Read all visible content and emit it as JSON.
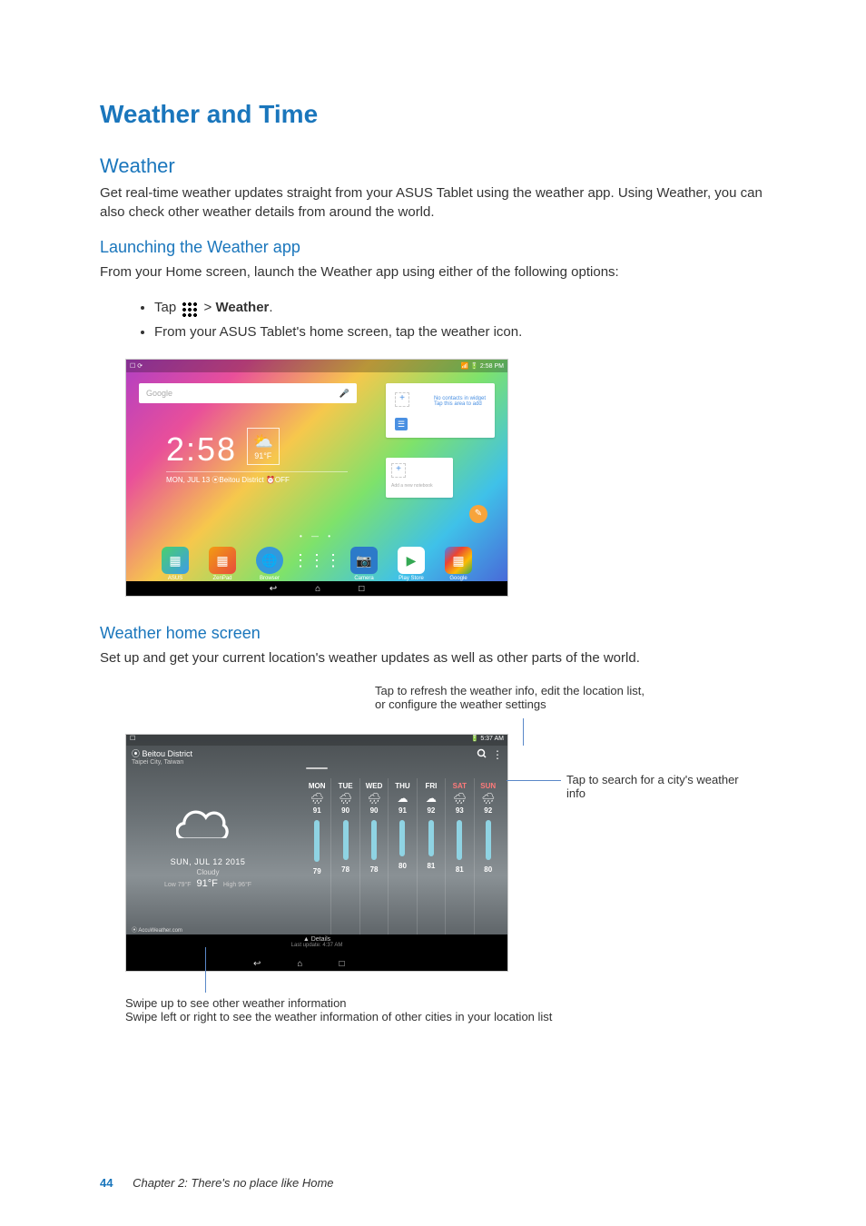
{
  "title": "Weather and Time",
  "weather_h": "Weather",
  "weather_p": "Get real-time weather updates straight from your ASUS Tablet using the weather app. Using Weather, you can also check other weather details from around the world.",
  "launch_h": "Launching the Weather app",
  "launch_p": "From your Home screen, launch the Weather app using either of the following options:",
  "li1_pre": "Tap",
  "li1_post": "> ",
  "li1_bold": "Weather",
  "li1_period": ".",
  "li2": "From your ASUS Tablet's home screen, tap the weather icon.",
  "home_h": "Weather home screen",
  "home_p": "Set up and get your current location's weather updates as well as other parts of the world.",
  "callout_top1": "Tap to refresh the weather info, edit the location list,",
  "callout_top2": "or configure the weather settings",
  "callout_right": "Tap to search for a city's weather info",
  "callout_bottom1": "Swipe up to see other weather information",
  "callout_bottom2": "Swipe left or right to see the weather information of other cities in your location list",
  "footer_page": "44",
  "footer_text": "Chapter 2: There's no place like Home",
  "s1": {
    "status_time": "2:58 PM",
    "search_placeholder": "Google",
    "clock_time": "2:58",
    "temp": "91°F",
    "dateline": "MON, JUL 13 ⦿Beitou District ⏰OFF",
    "contacts_line1": "No contacts in widget",
    "contacts_line2": "Tap this area to add",
    "addnote": "Add a new notebook",
    "dock": [
      "ASUS",
      "ZenPad",
      "Browser",
      "",
      "Camera",
      "Play Store",
      "Google"
    ]
  },
  "s2": {
    "status_time": "5:37 AM",
    "loc_name": "Beitou District",
    "loc_city": "Taipei City, Taiwan",
    "date": "SUN, JUL 12 2015",
    "condition": "Cloudy",
    "low": "Low 79°F",
    "current": "91°F",
    "high": "High 96°F",
    "details": "Details",
    "updated": "Last update: 4:37 AM",
    "accu": "AccuWeather.com",
    "days": [
      {
        "n": "MON",
        "icon": "rain",
        "hi": "91",
        "lo": "79",
        "bar": 46
      },
      {
        "n": "TUE",
        "icon": "rain",
        "hi": "90",
        "lo": "78",
        "bar": 44
      },
      {
        "n": "WED",
        "icon": "rain",
        "hi": "90",
        "lo": "78",
        "bar": 44
      },
      {
        "n": "THU",
        "icon": "cloud",
        "hi": "91",
        "lo": "80",
        "bar": 40
      },
      {
        "n": "FRI",
        "icon": "cloud",
        "hi": "92",
        "lo": "81",
        "bar": 40
      },
      {
        "n": "SAT",
        "icon": "rain",
        "hi": "93",
        "lo": "81",
        "bar": 44,
        "wkend": true
      },
      {
        "n": "SUN",
        "icon": "rain",
        "hi": "92",
        "lo": "80",
        "bar": 44,
        "wkend": true
      }
    ]
  }
}
